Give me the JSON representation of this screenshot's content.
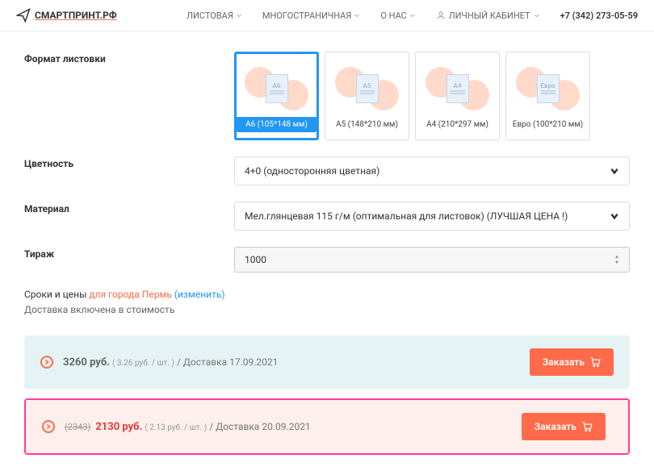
{
  "header": {
    "brand": "СМАРТПРИНТ.РФ",
    "nav": {
      "sheet": "ЛИСТОВАЯ",
      "multi": "МНОГОСТРАНИЧНАЯ",
      "about": "О НАС",
      "account": "ЛИЧНЫЙ КАБИНЕТ"
    },
    "phone": "+7 (342) 273-05-59"
  },
  "labels": {
    "format": "Формат листовки",
    "color": "Цветность",
    "material": "Материал",
    "quantity": "Тираж"
  },
  "formats": {
    "a6": {
      "tag": "A6",
      "label": "А6 (105*148 мм)"
    },
    "a5": {
      "tag": "A5",
      "label": "А5 (148*210 мм)"
    },
    "a4": {
      "tag": "A4",
      "label": "А4 (210*297 мм)"
    },
    "euro": {
      "tag": "Евро",
      "label": "Евро (100*210 мм)"
    }
  },
  "selects": {
    "color": "4+0 (односторонняя цветная)",
    "material": "Мел.глянцевая 115 г/м (оптимальная для листовок) (ЛУЧШАЯ ЦЕНА !)",
    "quantity": "1000"
  },
  "terms": {
    "lead": "Сроки и цены",
    "city": " для города Пермь ",
    "change": "(изменить)",
    "note": "Доставка включена в стоимость"
  },
  "offers": {
    "fast": {
      "price": "3260 руб.",
      "unit": "( 3.26 руб. / шт. )",
      "delivery": " / Доставка 17.09.2021",
      "btn": "Заказать"
    },
    "cheap": {
      "old": "(2343)",
      "price": "2130 руб.",
      "unit": "( 2.13 руб. / шт. )",
      "delivery": " / Доставка 20.09.2021",
      "btn": "Заказать"
    }
  }
}
